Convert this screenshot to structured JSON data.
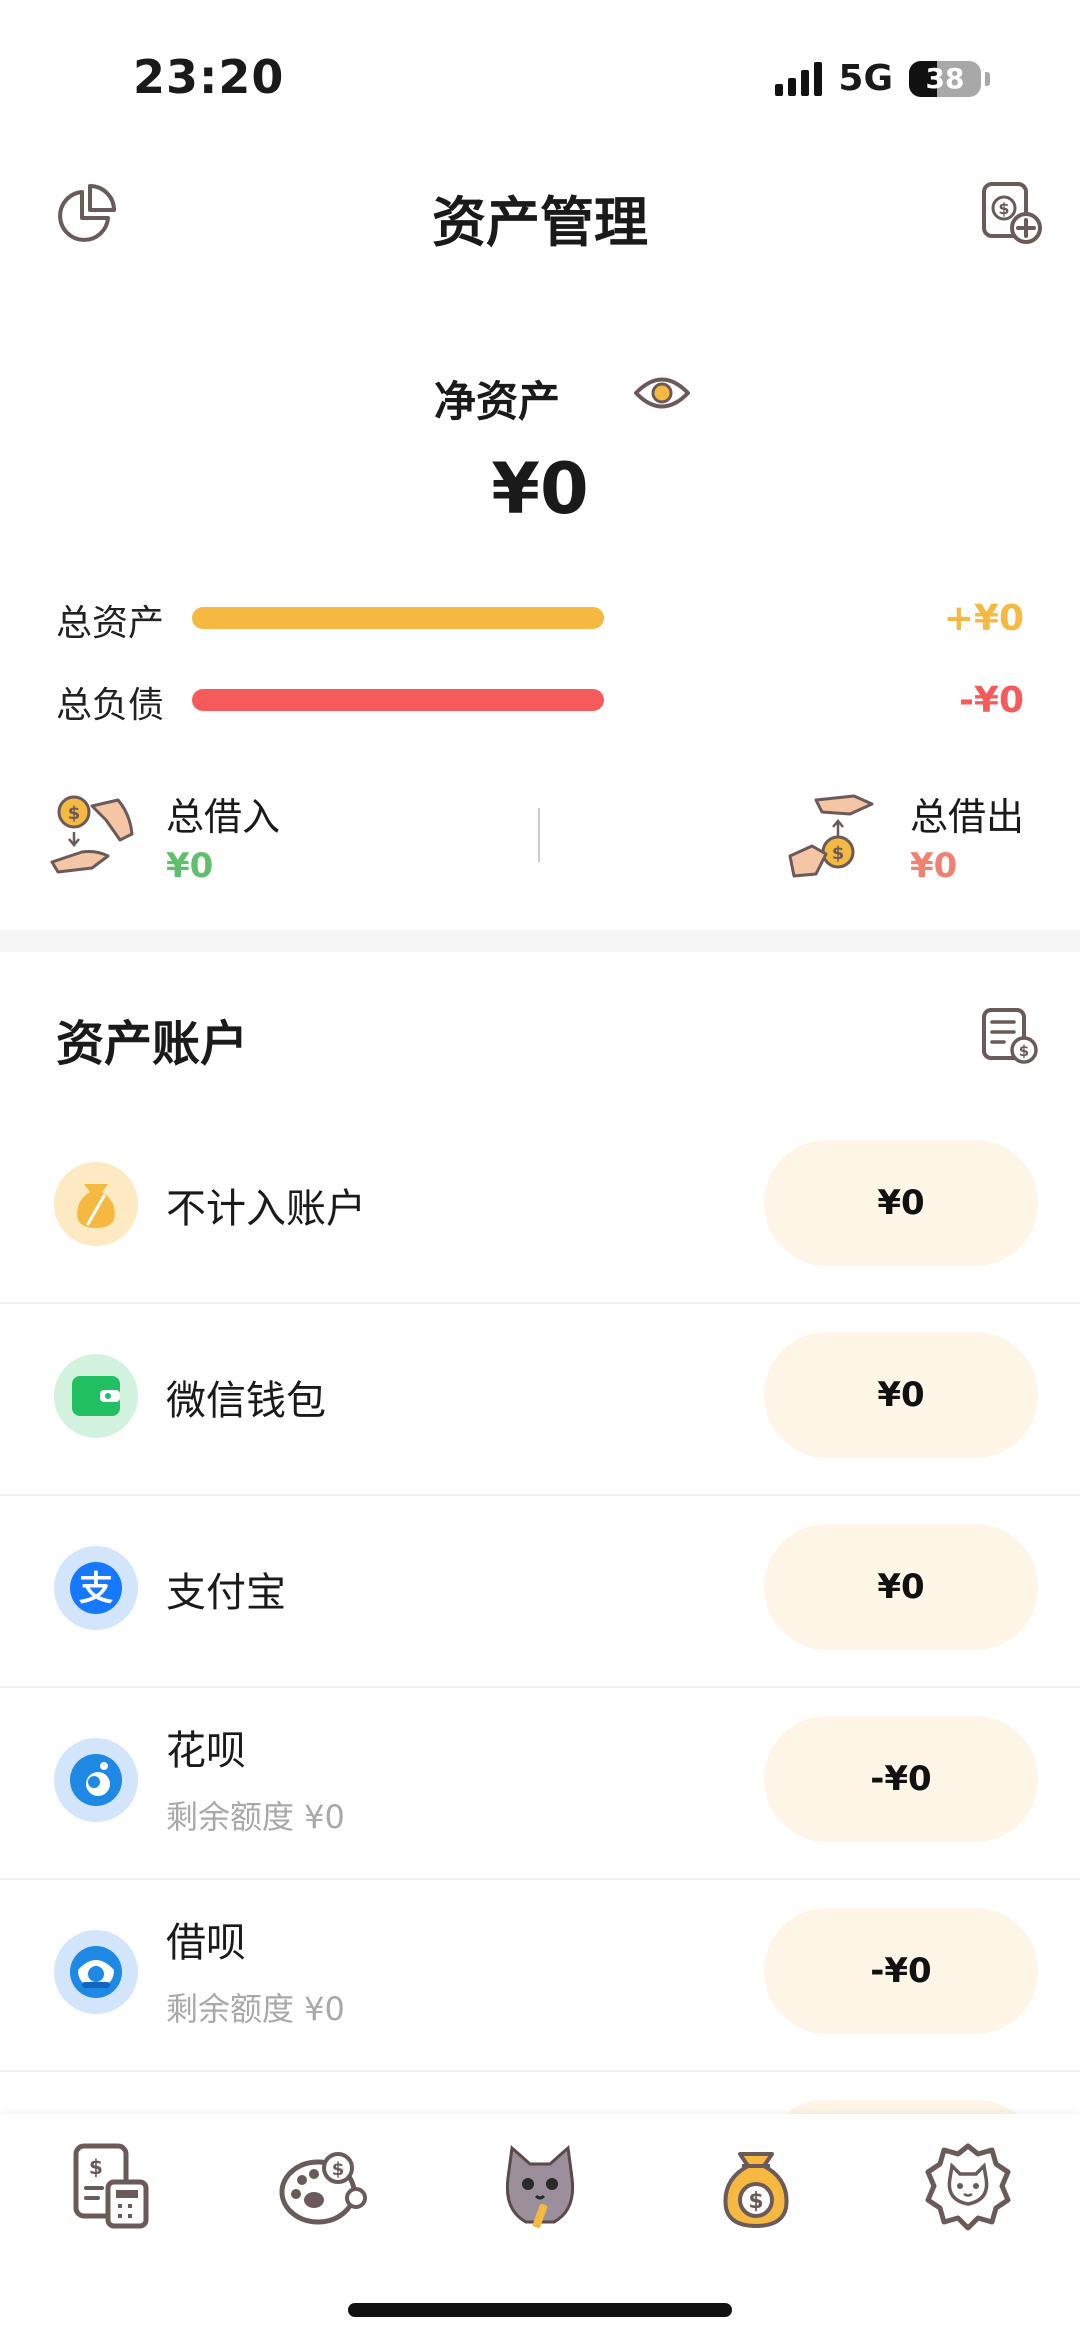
{
  "status": {
    "time": "23:20",
    "network": "5G",
    "battery": "38"
  },
  "header": {
    "title": "资产管理",
    "left_icon": "pie-chart-icon",
    "right_icon": "add-asset-icon"
  },
  "summary": {
    "net_label": "净资产",
    "net_amount": "¥0",
    "total_assets_label": "总资产",
    "total_assets_value": "+¥0",
    "total_liabilities_label": "总负债",
    "total_liabilities_value": "-¥0",
    "borrowed_label": "总借入",
    "borrowed_value": "¥0",
    "lent_label": "总借出",
    "lent_value": "¥0",
    "colors": {
      "assets": "#f5b942",
      "liabilities": "#f65b5b",
      "borrowed": "#5fbf6e",
      "lent": "#f08070"
    }
  },
  "accounts": {
    "title": "资产账户",
    "items": [
      {
        "name": "不计入账户",
        "sub": "",
        "amount": "¥0",
        "icon": "money-bag-icon",
        "color": "#fde9c2"
      },
      {
        "name": "微信钱包",
        "sub": "",
        "amount": "¥0",
        "icon": "wechat-wallet-icon",
        "color": "#d3f1df"
      },
      {
        "name": "支付宝",
        "sub": "",
        "amount": "¥0",
        "icon": "alipay-icon",
        "color": "#d3e5fb"
      },
      {
        "name": "花呗",
        "sub": "剩余额度 ¥0",
        "amount": "-¥0",
        "icon": "huabei-icon",
        "color": "#d3e5fb"
      },
      {
        "name": "借呗",
        "sub": "剩余额度 ¥0",
        "amount": "-¥0",
        "icon": "jiebei-icon",
        "color": "#d3e5fb"
      }
    ]
  },
  "tabbar": {
    "items": [
      {
        "icon": "bill-calculator-icon"
      },
      {
        "icon": "budget-paw-icon"
      },
      {
        "icon": "cat-mascot-icon"
      },
      {
        "icon": "money-bag-icon"
      },
      {
        "icon": "cat-settings-icon"
      }
    ]
  }
}
